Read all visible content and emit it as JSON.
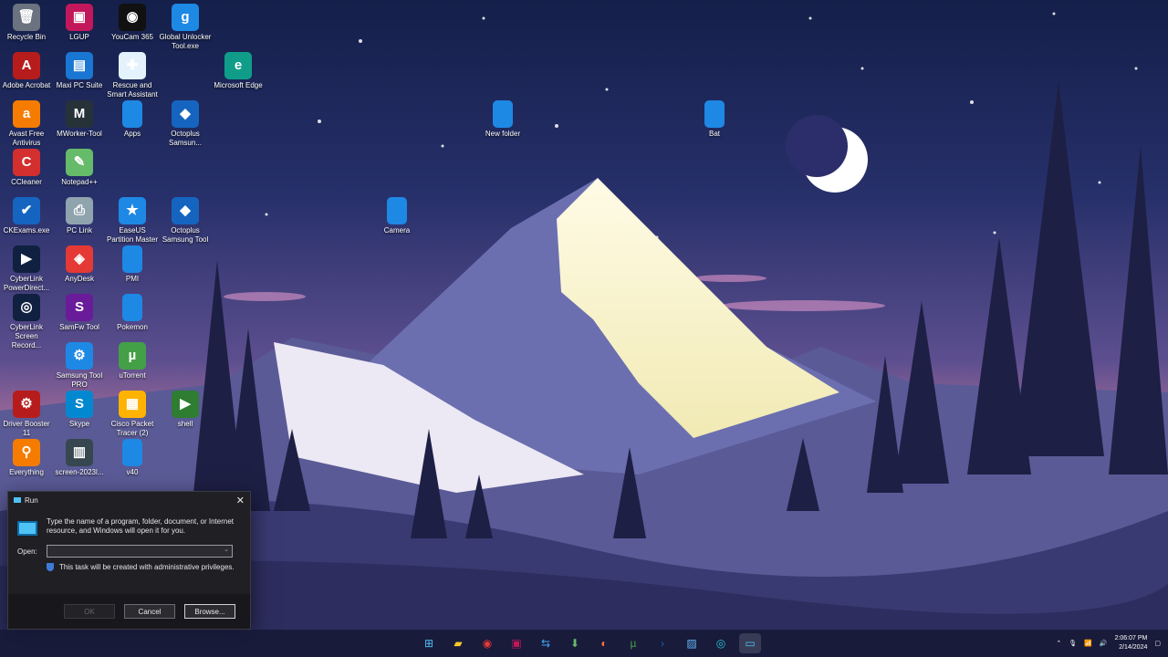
{
  "desktop": {
    "icons": [
      {
        "label": "Recycle Bin",
        "icon": "recycle-bin-icon",
        "glyph": "🗑",
        "color": "#6b7280"
      },
      {
        "label": "LGUP",
        "icon": "lgup-icon",
        "glyph": "▣",
        "color": "#c2185b"
      },
      {
        "label": "YouCam 365",
        "icon": "youcam-icon",
        "glyph": "◉",
        "color": "#111"
      },
      {
        "label": "Global Unlocker Tool.exe",
        "icon": "global-unlocker-icon",
        "glyph": "g",
        "color": "#1e88e5"
      },
      {
        "label": "Adobe Acrobat",
        "icon": "adobe-acrobat-icon",
        "glyph": "A",
        "color": "#b71c1c"
      },
      {
        "label": "Maxi PC Suite",
        "icon": "maxi-pc-suite-icon",
        "glyph": "▤",
        "color": "#1976d2"
      },
      {
        "label": "Rescue and Smart Assistant",
        "icon": "rescue-assistant-icon",
        "glyph": "✚",
        "color": "#e3f2fd"
      },
      {
        "label": "Microsoft Edge",
        "icon": "edge-icon",
        "glyph": "e",
        "color": "#0f9d8a"
      },
      {
        "label": "Avast Free Antivirus",
        "icon": "avast-icon",
        "glyph": "a",
        "color": "#f57c00"
      },
      {
        "label": "MWorker-Tool",
        "icon": "mworker-icon",
        "glyph": "M",
        "color": "#263238"
      },
      {
        "label": "Apps",
        "icon": "folder-icon",
        "glyph": "",
        "color": "#1e88e5"
      },
      {
        "label": "Octoplus Samsun...",
        "icon": "octoplus-new-icon",
        "glyph": "◆",
        "color": "#1565c0"
      },
      {
        "label": "New folder",
        "icon": "folder-icon",
        "glyph": "",
        "color": "#1e88e5"
      },
      {
        "label": "Bat",
        "icon": "folder-icon",
        "glyph": "",
        "color": "#1e88e5"
      },
      {
        "label": "CCleaner",
        "icon": "ccleaner-icon",
        "glyph": "C",
        "color": "#d32f2f"
      },
      {
        "label": "Notepad++",
        "icon": "notepad-plus-icon",
        "glyph": "✎",
        "color": "#66bb6a"
      },
      {
        "label": "CKExams.exe",
        "icon": "ckexams-icon",
        "glyph": "✔",
        "color": "#1565c0"
      },
      {
        "label": "PC Link",
        "icon": "pc-link-icon",
        "glyph": "⎙",
        "color": "#90a4ae"
      },
      {
        "label": "EaseUS Partition Master",
        "icon": "easeus-icon",
        "glyph": "★",
        "color": "#1e88e5"
      },
      {
        "label": "Octoplus Samsung Tool",
        "icon": "octoplus-classic-icon",
        "glyph": "◆",
        "color": "#1565c0"
      },
      {
        "label": "Camera",
        "icon": "folder-icon",
        "glyph": "",
        "color": "#1e88e5"
      },
      {
        "label": "CyberLink PowerDirect...",
        "icon": "powerdirector-icon",
        "glyph": "▶",
        "color": "#102040"
      },
      {
        "label": "AnyDesk",
        "icon": "anydesk-icon",
        "glyph": "◈",
        "color": "#e53935"
      },
      {
        "label": "PMI",
        "icon": "folder-icon",
        "glyph": "",
        "color": "#1e88e5"
      },
      {
        "label": "CyberLink Screen Record...",
        "icon": "screen-recorder-icon",
        "glyph": "◎",
        "color": "#102040"
      },
      {
        "label": "SamFw Tool",
        "icon": "samfw-icon",
        "glyph": "S",
        "color": "#6a1b9a"
      },
      {
        "label": "Pokemon",
        "icon": "folder-icon",
        "glyph": "",
        "color": "#1e88e5"
      },
      {
        "label": "Samsung Tool PRO",
        "icon": "samsung-tool-pro-icon",
        "glyph": "⚙",
        "color": "#1e88e5"
      },
      {
        "label": "uTorrent",
        "icon": "utorrent-icon",
        "glyph": "µ",
        "color": "#43a047"
      },
      {
        "label": "Driver Booster 11",
        "icon": "driver-booster-icon",
        "glyph": "⚙",
        "color": "#b71c1c"
      },
      {
        "label": "Skype",
        "icon": "skype-icon",
        "glyph": "S",
        "color": "#0288d1"
      },
      {
        "label": "Cisco Packet Tracer (2)",
        "icon": "packet-tracer-icon",
        "glyph": "▦",
        "color": "#ffb300"
      },
      {
        "label": "shell",
        "icon": "shell-icon",
        "glyph": "▶",
        "color": "#2e7d32"
      },
      {
        "label": "Everything",
        "icon": "everything-icon",
        "glyph": "⚲",
        "color": "#f57c00"
      },
      {
        "label": "screen-2023l...",
        "icon": "screenshot-file-icon",
        "glyph": "▥",
        "color": "#37474f"
      },
      {
        "label": "v40",
        "icon": "folder-icon",
        "glyph": "",
        "color": "#1e88e5"
      }
    ]
  },
  "run_dialog": {
    "title": "Run",
    "description": "Type the name of a program, folder, document, or Internet resource, and Windows will open it for you.",
    "open_label": "Open:",
    "open_value": "",
    "admin_note": "This task will be created with administrative privileges.",
    "ok_label": "OK",
    "cancel_label": "Cancel",
    "browse_label": "Browse..."
  },
  "taskbar": {
    "apps": [
      {
        "name": "start-button",
        "glyph": "⊞",
        "color": "#4fc3f7"
      },
      {
        "name": "file-explorer-icon",
        "glyph": "▰",
        "color": "#ffca28"
      },
      {
        "name": "chrome-icon",
        "glyph": "◉",
        "color": "#e53935"
      },
      {
        "name": "lgup-taskbar-icon",
        "glyph": "▣",
        "color": "#c2185b"
      },
      {
        "name": "remote-app-icon",
        "glyph": "⇆",
        "color": "#42a5f5"
      },
      {
        "name": "download-app-icon",
        "glyph": "⬇",
        "color": "#66bb6a"
      },
      {
        "name": "firefox-icon",
        "glyph": "◐",
        "color": "#ff7043"
      },
      {
        "name": "utorrent-taskbar-icon",
        "glyph": "µ",
        "color": "#43a047"
      },
      {
        "name": "powershell-icon",
        "glyph": "›",
        "color": "#1565c0"
      },
      {
        "name": "photos-icon",
        "glyph": "▨",
        "color": "#64b5f6"
      },
      {
        "name": "screen-recorder-taskbar-icon",
        "glyph": "◎",
        "color": "#26c6da"
      },
      {
        "name": "run-taskbar-icon",
        "glyph": "▭",
        "color": "#4fc3f7"
      }
    ],
    "time": "2:06:07 PM",
    "date": "2/14/2024"
  }
}
